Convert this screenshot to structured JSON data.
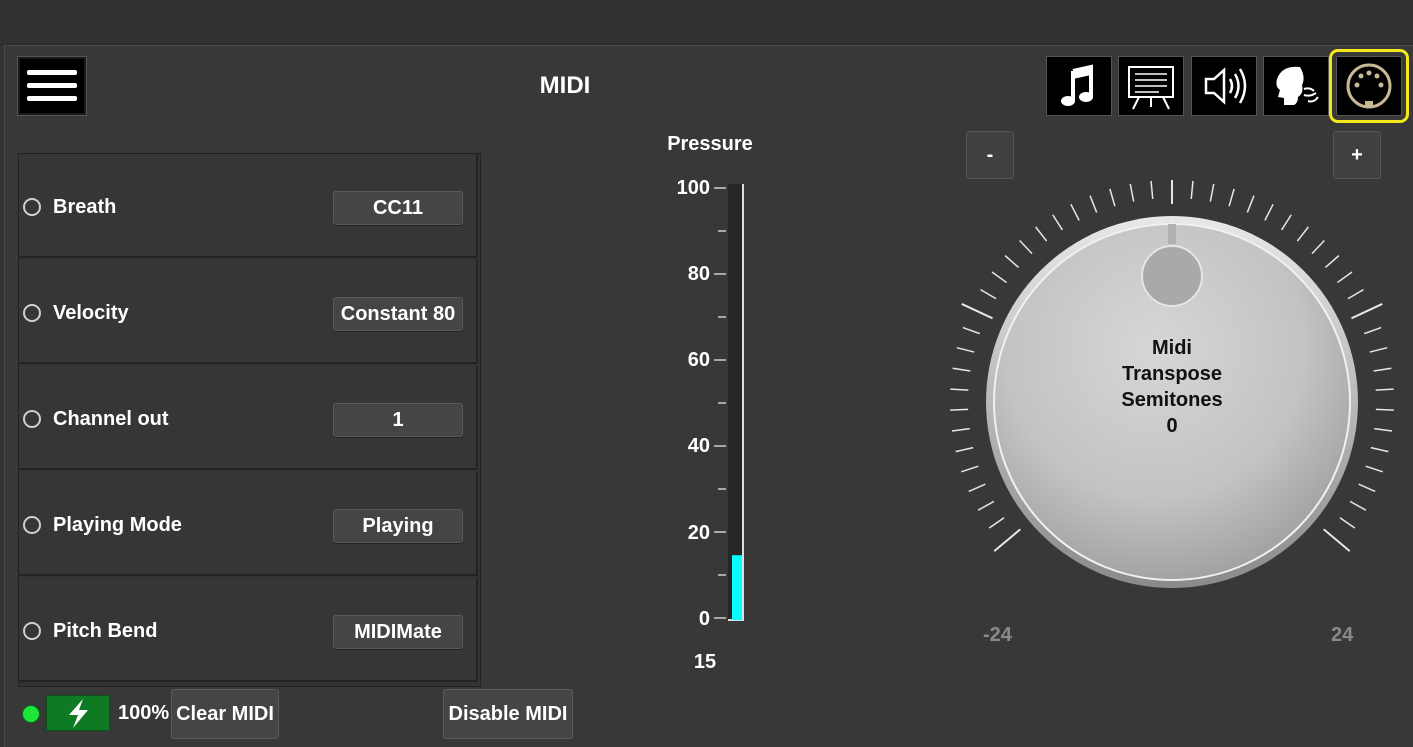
{
  "header": {
    "title": "MIDI"
  },
  "toolbar": {
    "menu_icon": "hamburger-menu-icon",
    "tabs": [
      {
        "icon": "music-note-icon"
      },
      {
        "icon": "sheet-music-stand-icon"
      },
      {
        "icon": "speaker-volume-icon"
      },
      {
        "icon": "head-breath-icon"
      },
      {
        "icon": "midi-din-connector-icon",
        "selected": true
      }
    ],
    "highlight_color": "#f2e81a"
  },
  "params": [
    {
      "label": "Breath",
      "value": "CC11"
    },
    {
      "label": "Velocity",
      "value": "Constant 80"
    },
    {
      "label": "Channel out",
      "value": "1"
    },
    {
      "label": "Playing Mode",
      "value": "Playing"
    },
    {
      "label": "Pitch Bend",
      "value": "MIDIMate"
    }
  ],
  "pressure": {
    "title": "Pressure",
    "ticks": [
      "100",
      "80",
      "60",
      "40",
      "20",
      "0"
    ],
    "value": "15",
    "level": 15,
    "max": 100,
    "fill_color": "#00ffff"
  },
  "transpose": {
    "minus_label": "-",
    "plus_label": "+",
    "line1": "Midi",
    "line2": "Transpose",
    "line3": "Semitones",
    "value": "0",
    "min_label": "-24",
    "max_label": "24"
  },
  "footer": {
    "battery_icon": "battery-charging-icon",
    "battery_pct": "100%",
    "clear_midi": "Clear MIDI",
    "disable_midi": "Disable MIDI",
    "status_color": "#1ee53a"
  }
}
